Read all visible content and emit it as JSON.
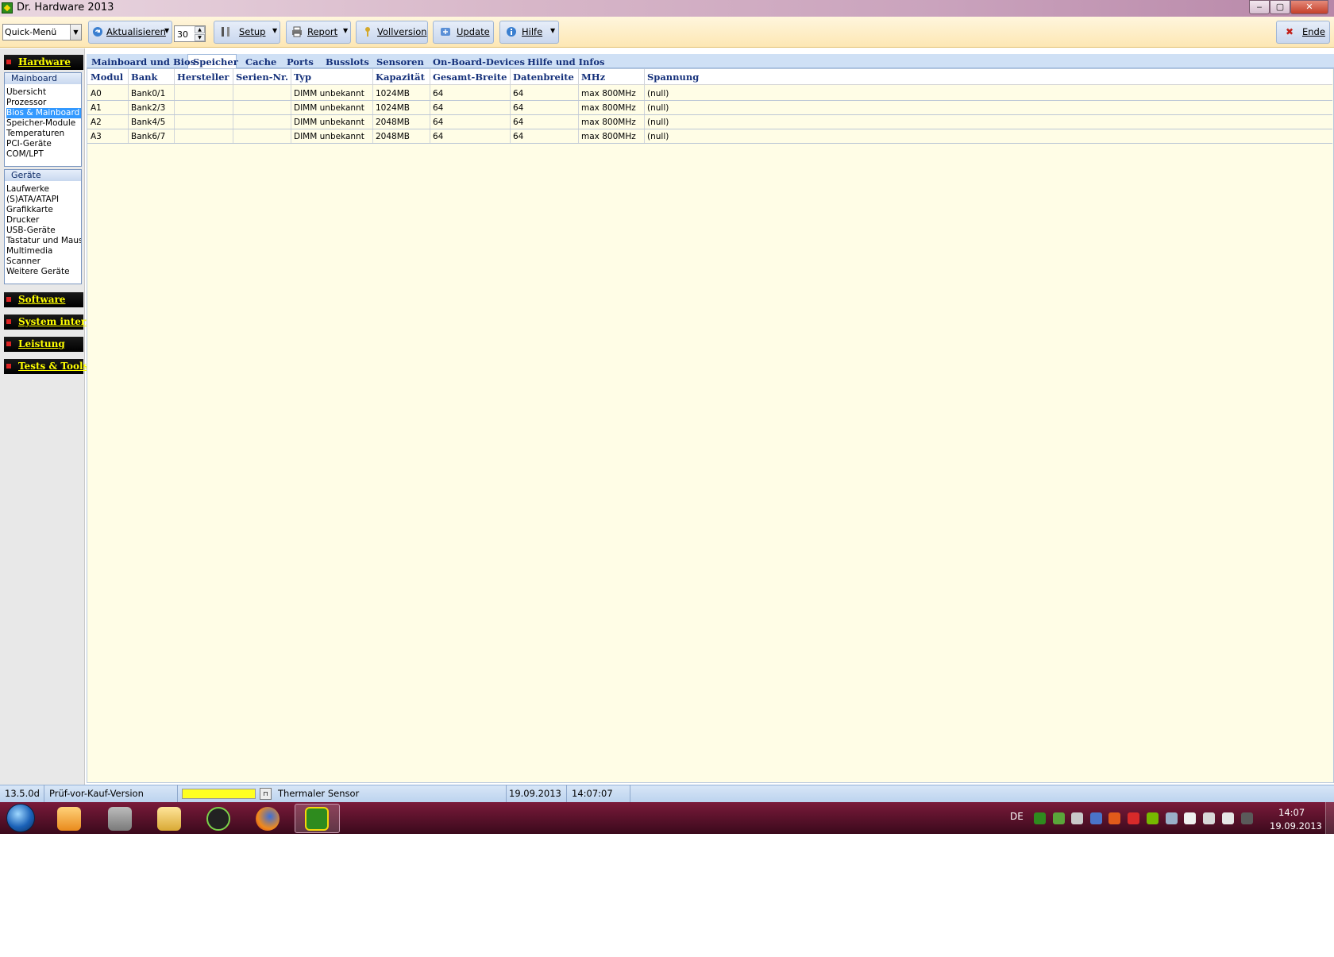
{
  "window": {
    "title": "Dr. Hardware 2013",
    "controls": {
      "minimize": "‒",
      "maximize": "▢",
      "close": "✕"
    }
  },
  "toolbar": {
    "quick_menu": "Quick-Menü",
    "refresh_label": "Aktualisieren",
    "refresh_interval": "30",
    "setup_label": "Setup",
    "report_label": "Report",
    "fullversion_label": "Vollversion",
    "update_label": "Update",
    "help_label": "Hilfe",
    "exit_label": "Ende"
  },
  "sidebar": {
    "hardware": "Hardware",
    "mainboard_title": "Mainboard",
    "mainboard_items": [
      "Übersicht",
      "Prozessor",
      "Bios & Mainboard",
      "Speicher-Module",
      "Temperaturen",
      "PCI-Geräte",
      "COM/LPT"
    ],
    "mainboard_selected": "Bios & Mainboard",
    "devices_title": "Geräte",
    "devices_items": [
      "Laufwerke",
      "(S)ATA/ATAPI",
      "Grafikkarte",
      "Drucker",
      "USB-Geräte",
      "Tastatur und Maus",
      "Multimedia",
      "Scanner",
      "Weitere Geräte"
    ],
    "software": "Software",
    "system_intern": "System intern",
    "leistung": "Leistung",
    "tests_tools": "Tests & Tools"
  },
  "tabs": [
    "Mainboard und Bios",
    "Speicher",
    "Cache",
    "Ports",
    "Busslots",
    "Sensoren",
    "On-Board-Devices",
    "Hilfe und Infos"
  ],
  "active_tab": "Speicher",
  "table": {
    "columns": [
      "Modul",
      "Bank",
      "Hersteller",
      "Serien-Nr.",
      "Typ",
      "Kapazität",
      "Gesamt-Breite",
      "Datenbreite",
      "MHz",
      "Spannung"
    ],
    "rows": [
      [
        "A0",
        "Bank0/1",
        "",
        "",
        "DIMM unbekannt",
        "1024MB",
        "64",
        "64",
        "max 800MHz",
        "(null)"
      ],
      [
        "A1",
        "Bank2/3",
        "",
        "",
        "DIMM unbekannt",
        "1024MB",
        "64",
        "64",
        "max 800MHz",
        "(null)"
      ],
      [
        "A2",
        "Bank4/5",
        "",
        "",
        "DIMM unbekannt",
        "2048MB",
        "64",
        "64",
        "max 800MHz",
        "(null)"
      ],
      [
        "A3",
        "Bank6/7",
        "",
        "",
        "DIMM unbekannt",
        "2048MB",
        "64",
        "64",
        "max 800MHz",
        "(null)"
      ]
    ]
  },
  "statusbar": {
    "version": "13.5.0d",
    "edition": "Prüf-vor-Kauf-Version",
    "sensor": "Thermaler Sensor",
    "date": "19.09.2013",
    "time": "14:07:07"
  },
  "taskbar": {
    "language": "DE",
    "clock_time": "14:07",
    "clock_date": "19.09.2013",
    "apps": [
      "media-player-icon",
      "java-icon",
      "explorer-icon",
      "spotify-icon",
      "firefox-icon",
      "dr-hardware-icon"
    ]
  },
  "colors": {
    "panel_bg": "#fffde6",
    "selection": "#3399ff",
    "section_label": "#ffff00",
    "header_text": "#14307a"
  }
}
